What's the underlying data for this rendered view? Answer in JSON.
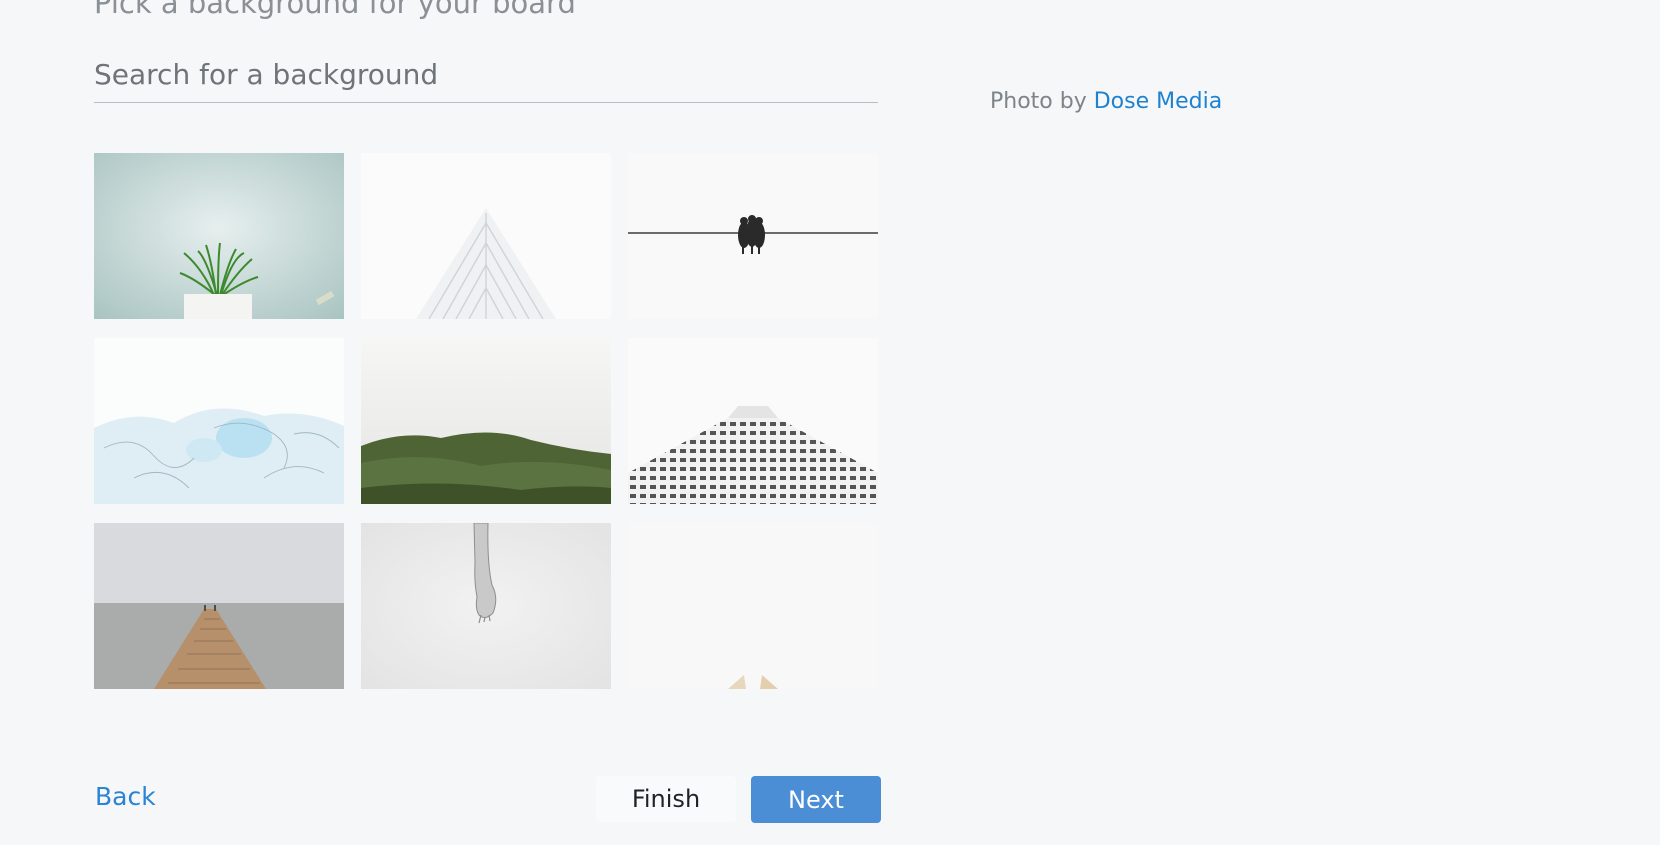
{
  "heading": "Pick a background for your board",
  "search": {
    "placeholder": "Search for a background",
    "value": ""
  },
  "credit": {
    "prefix": "Photo by ",
    "author": "Dose Media"
  },
  "backgrounds": [
    {
      "subject": "potted grass plant on mint wall"
    },
    {
      "subject": "white skyscraper in fog"
    },
    {
      "subject": "birds on a wire"
    },
    {
      "subject": "icy blue abstract"
    },
    {
      "subject": "green hills in fog"
    },
    {
      "subject": "building facade looking up"
    },
    {
      "subject": "wooden pier into calm sea"
    },
    {
      "subject": "hand on white background"
    },
    {
      "subject": "white paper planes"
    }
  ],
  "footer": {
    "back_label": "Back",
    "finish_label": "Finish",
    "next_label": "Next"
  },
  "colors": {
    "page_background": "#f5f7f9",
    "link": "#2b83d3",
    "primary_button": "#4b8ed6"
  }
}
